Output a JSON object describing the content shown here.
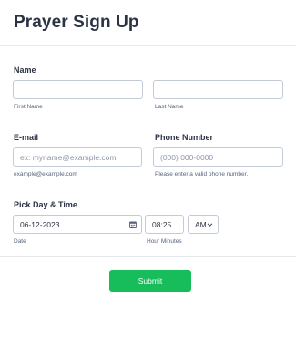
{
  "form": {
    "title": "Prayer Sign Up"
  },
  "name_section": {
    "label": "Name",
    "first_name": {
      "value": "",
      "sublabel": "First Name"
    },
    "last_name": {
      "value": "",
      "sublabel": "Last Name"
    }
  },
  "email_section": {
    "label": "E-mail",
    "placeholder": "ex: myname@example.com",
    "sublabel": "example@example.com"
  },
  "phone_section": {
    "label": "Phone Number",
    "placeholder": "(000) 000-0000",
    "sublabel": "Please enter a valid phone number."
  },
  "datetime_section": {
    "label": "Pick Day & Time",
    "date_value": "06-12-2023",
    "date_sublabel": "Date",
    "time_value": "08:25",
    "ampm_value": "AM",
    "time_sublabel": "Hour Minutes"
  },
  "actions": {
    "submit_label": "Submit"
  },
  "colors": {
    "accent": "#18bd5b",
    "text": "#2c3345",
    "border": "#c3cad8"
  }
}
